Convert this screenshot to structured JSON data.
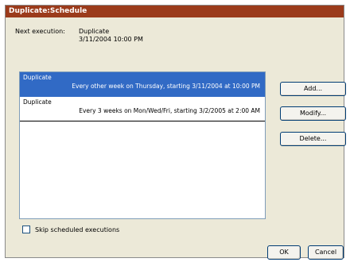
{
  "window": {
    "title": "Duplicate:Schedule"
  },
  "next_execution": {
    "label": "Next execution:",
    "name": "Duplicate",
    "datetime": "3/11/2004 10:00 PM"
  },
  "schedules": [
    {
      "name": "Duplicate",
      "description": "Every other week on Thursday, starting 3/11/2004 at 10:00 PM",
      "selected": true
    },
    {
      "name": "Duplicate",
      "description": "Every 3 weeks on Mon/Wed/Fri, starting 3/2/2005 at 2:00 AM",
      "selected": false
    }
  ],
  "buttons": {
    "add": "Add...",
    "modify": "Modify...",
    "delete": "Delete...",
    "ok": "OK",
    "cancel": "Cancel"
  },
  "skip_checkbox": {
    "label": "Skip scheduled executions",
    "checked": false
  },
  "colors": {
    "titlebar": "#9B3B1B",
    "selection": "#316AC5",
    "dialog_bg": "#ECE9D8"
  }
}
